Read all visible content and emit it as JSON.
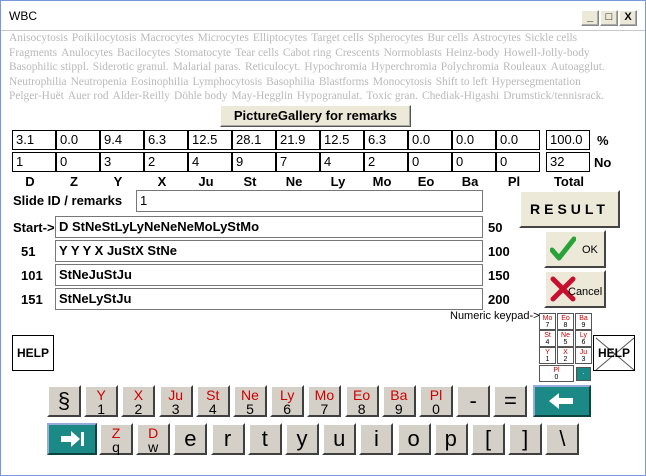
{
  "window": {
    "title": "WBC",
    "min_label": "_",
    "max_label": "□",
    "close_label": "X"
  },
  "banner": {
    "lines": [
      [
        "Anisocytosis",
        "Poikilocytosis",
        "Macrocytes",
        "Microcytes",
        "Elliptocytes",
        "Target cells",
        "Spherocytes",
        "Bur cells",
        "Astrocytes",
        "Sickle cells"
      ],
      [
        "Fragments",
        "Anulocytes",
        "Bacilocytes",
        "Stomatocyte",
        "Tear cells",
        "Cabot ring",
        "Crescents",
        "Normoblasts",
        "Heinz-body",
        "Howell-Jolly-body"
      ],
      [
        "Basophilic stippl.",
        "Siderotic granul.",
        "Malarial paras.",
        "Reticulocyt.",
        "Hypochromia",
        "Hyperchromia",
        "Polychromia",
        "Rouleaux",
        "Autoagglut."
      ],
      [
        "Neutrophilia",
        "Neutropenia",
        "Eosinophilia",
        "Lymphocytosis",
        "Basophilia",
        "Blastforms",
        "Monocytosis",
        "Shift to left",
        "Hypersegmentation"
      ],
      [
        "Pelger-Huët",
        "Auer rod",
        "Alder-Reilly",
        "Döhle body",
        "May-Hegglin",
        "Hypogranulat.",
        "Toxic gran.",
        "Chediak-Higashi",
        "Drumstick/tennisrack."
      ]
    ]
  },
  "gallery_button": "PictureGallery for remarks",
  "percent": [
    "3.1",
    "0.0",
    "9.4",
    "6.3",
    "12.5",
    "28.1",
    "21.9",
    "12.5",
    "6.3",
    "0.0",
    "0.0",
    "0.0"
  ],
  "counts": [
    "1",
    "0",
    "3",
    "2",
    "4",
    "9",
    "7",
    "4",
    "2",
    "0",
    "0",
    "0"
  ],
  "total_percent": "100.0",
  "total_count": "32",
  "unit_percent": "%",
  "unit_no": "No",
  "headers": [
    "D",
    "Z",
    "Y",
    "X",
    "Ju",
    "St",
    "Ne",
    "Ly",
    "Mo",
    "Eo",
    "Ba",
    "Pl"
  ],
  "total_header": "Total",
  "slide": {
    "label": "Slide ID / remarks",
    "value": "1"
  },
  "sequence": [
    {
      "label": "Start->",
      "text": "D StNeStLyLyNeNeNeMoLyStMo",
      "count": "50"
    },
    {
      "label": "51",
      "text": "Y Y Y X JuStX StNe",
      "count": "100"
    },
    {
      "label": "101",
      "text": "StNeJuStJu",
      "count": "150"
    },
    {
      "label": "151",
      "text": "StNeLyStJu",
      "count": "200"
    }
  ],
  "buttons": {
    "result": "RESULT",
    "ok": "OK",
    "cancel": "Cancel",
    "help": "HELP",
    "help2": "HELP"
  },
  "keypad_label": "Numeric keypad->",
  "mini_keypad": [
    {
      "t": "Mo",
      "n": "7"
    },
    {
      "t": "Eo",
      "n": "8"
    },
    {
      "t": "Ba",
      "n": "9"
    },
    {
      "t": "St",
      "n": "4"
    },
    {
      "t": "Ne",
      "n": "5"
    },
    {
      "t": "Ly",
      "n": "6"
    },
    {
      "t": "Y",
      "n": "1"
    },
    {
      "t": "X",
      "n": "2"
    },
    {
      "t": "Ju",
      "n": "3"
    },
    {
      "t": "Pl",
      "n": "0"
    },
    {
      "t": "",
      "n": "."
    }
  ],
  "keys_row1": [
    {
      "t": "",
      "n": "§"
    },
    {
      "t": "Y",
      "n": "1"
    },
    {
      "t": "X",
      "n": "2"
    },
    {
      "t": "Ju",
      "n": "3"
    },
    {
      "t": "St",
      "n": "4"
    },
    {
      "t": "Ne",
      "n": "5"
    },
    {
      "t": "Ly",
      "n": "6"
    },
    {
      "t": "Mo",
      "n": "7"
    },
    {
      "t": "Eo",
      "n": "8"
    },
    {
      "t": "Ba",
      "n": "9"
    },
    {
      "t": "Pl",
      "n": "0"
    },
    {
      "t": "",
      "n": "-"
    },
    {
      "t": "",
      "n": "="
    }
  ],
  "keys_row2": [
    {
      "t": "Z",
      "n": "q"
    },
    {
      "t": "D",
      "n": "w"
    },
    {
      "t": "",
      "n": "e"
    },
    {
      "t": "",
      "n": "r"
    },
    {
      "t": "",
      "n": "t"
    },
    {
      "t": "",
      "n": "y"
    },
    {
      "t": "",
      "n": "u"
    },
    {
      "t": "",
      "n": "i"
    },
    {
      "t": "",
      "n": "o"
    },
    {
      "t": "",
      "n": "p"
    },
    {
      "t": "",
      "n": "["
    },
    {
      "t": "",
      "n": "]"
    },
    {
      "t": "",
      "n": "\\"
    }
  ],
  "colors": {
    "accent_red": "#cc0000",
    "teal": "#1b8a86",
    "check_green": "#2aa23a",
    "x_red": "#c8102e"
  }
}
